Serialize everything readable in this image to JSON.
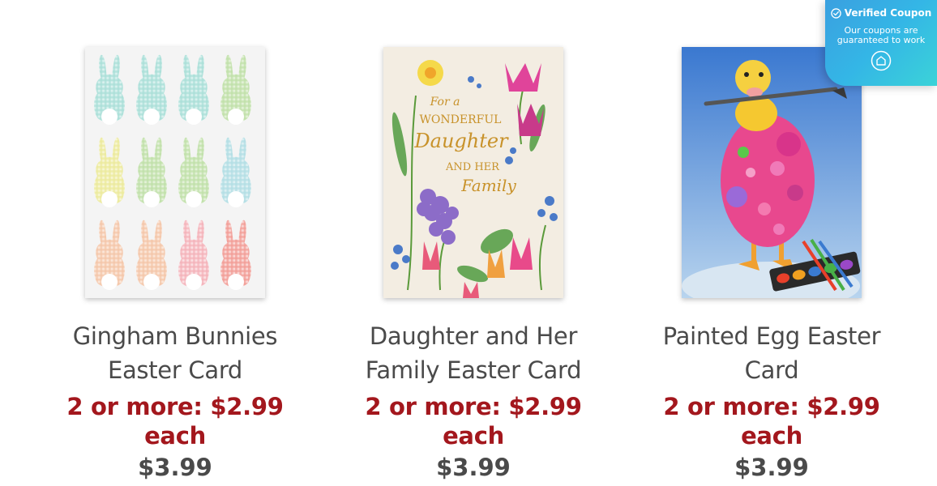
{
  "coupon_badge": {
    "title": "Verified Coupon",
    "subtitle_line1": "Our coupons are",
    "subtitle_line2": "guaranteed to work",
    "icon": "coupon-tag-icon",
    "color_start": "#3aa0e0",
    "color_end": "#3bd3d8"
  },
  "products": [
    {
      "title_line1": "Gingham Bunnies",
      "title_line2": "Easter Card",
      "promo": "2 or more: $2.99 each",
      "price": "$3.99",
      "image": "gingham-bunnies-card-image"
    },
    {
      "title_line1": "Daughter and Her",
      "title_line2": "Family Easter Card",
      "promo": "2 or more: $2.99 each",
      "price": "$3.99",
      "image": "daughter-family-card-image",
      "image_text": {
        "line1": "For a",
        "line2": "WONDERFUL",
        "line3": "Daughter",
        "line4": "AND HER",
        "line5": "Family"
      }
    },
    {
      "title_line1": "Painted Egg Easter",
      "title_line2": "Card",
      "promo": "2 or more: $2.99 each",
      "price": "$3.99",
      "image": "painted-egg-card-image"
    }
  ],
  "colors": {
    "promo": "#a3171d",
    "text": "#4a4a4a"
  }
}
